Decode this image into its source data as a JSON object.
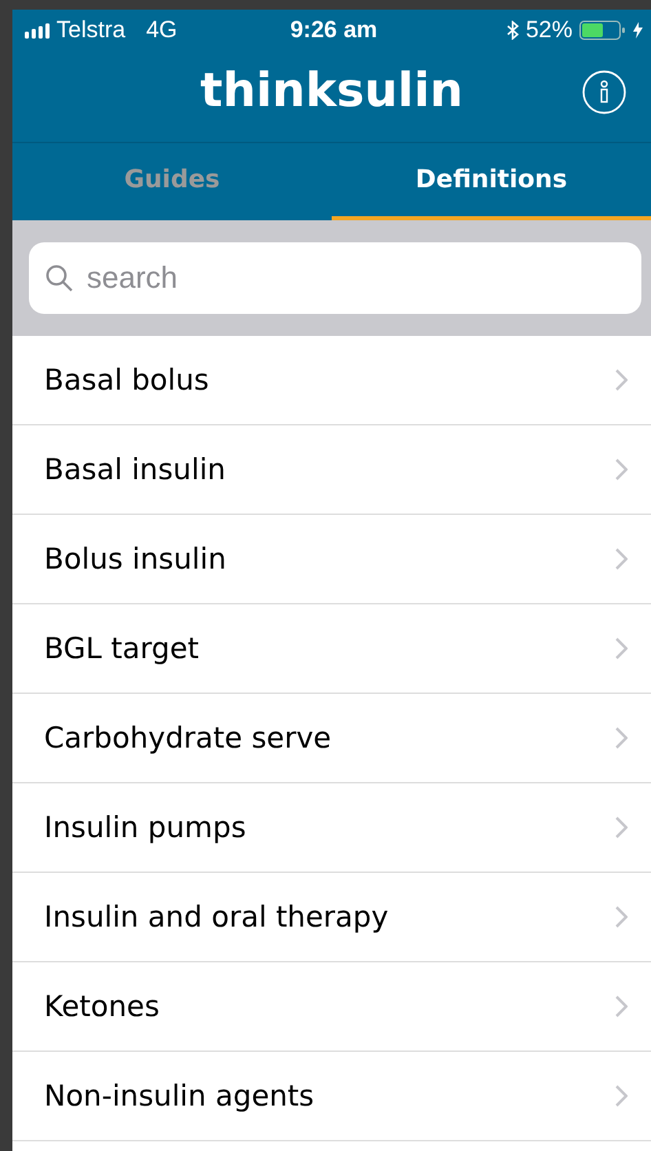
{
  "status_bar": {
    "carrier": "Telstra",
    "network": "4G",
    "time": "9:26 am",
    "battery": "52%"
  },
  "header": {
    "title": "thinksulin"
  },
  "tabs": [
    {
      "label": "Guides",
      "selected": false
    },
    {
      "label": "Definitions",
      "selected": true
    }
  ],
  "search": {
    "placeholder": "search"
  },
  "items": [
    {
      "label": "Basal bolus"
    },
    {
      "label": "Basal insulin"
    },
    {
      "label": "Bolus insulin"
    },
    {
      "label": "BGL target"
    },
    {
      "label": "Carbohydrate serve"
    },
    {
      "label": "Insulin pumps"
    },
    {
      "label": "Insulin and oral therapy"
    },
    {
      "label": "Ketones"
    },
    {
      "label": "Non-insulin agents"
    }
  ]
}
